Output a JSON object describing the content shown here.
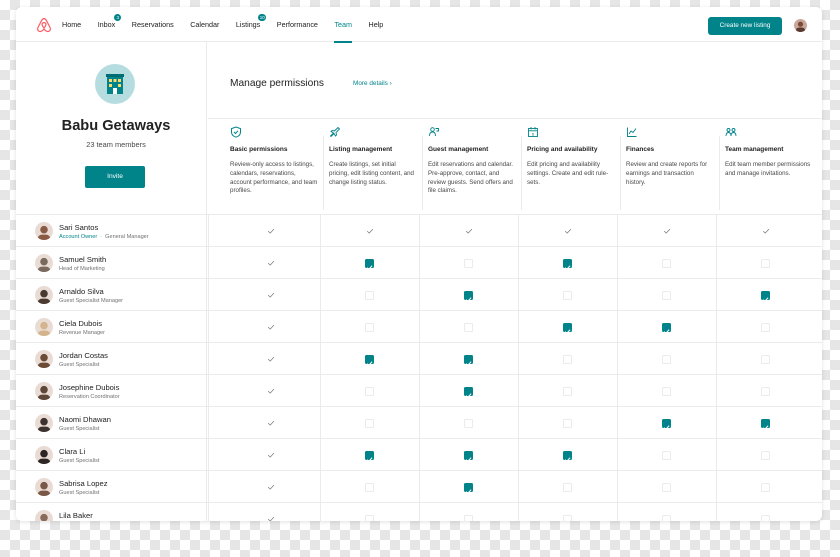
{
  "nav": {
    "items": [
      {
        "label": "Home",
        "badge": null,
        "active": false
      },
      {
        "label": "Inbox",
        "badge": "3",
        "active": false
      },
      {
        "label": "Reservations",
        "badge": null,
        "active": false
      },
      {
        "label": "Calendar",
        "badge": null,
        "active": false
      },
      {
        "label": "Listings",
        "badge": "10",
        "active": false
      },
      {
        "label": "Performance",
        "badge": null,
        "active": false
      },
      {
        "label": "Team",
        "badge": null,
        "active": true
      },
      {
        "label": "Help",
        "badge": null,
        "active": false
      }
    ],
    "create_button": "Create new listing"
  },
  "team": {
    "name": "Babu Getaways",
    "member_count": "23 team members",
    "invite_label": "Invite"
  },
  "permissions": {
    "title": "Manage permissions",
    "more_details": "More details",
    "columns": [
      {
        "name": "Basic permissions",
        "icon": "shield-icon",
        "description": "Review-only access to listings, calendars, reservations, account performance, and team profiles."
      },
      {
        "name": "Listing management",
        "icon": "pin-icon",
        "description": "Create listings, set initial pricing, edit listing content, and change listing status."
      },
      {
        "name": "Guest management",
        "icon": "guests-icon",
        "description": "Edit reservations and calendar. Pre-approve, contact, and review guests. Send offers and file claims."
      },
      {
        "name": "Pricing and availability",
        "icon": "calendar-icon",
        "description": "Edit pricing and availability settings. Create and edit rule-sets."
      },
      {
        "name": "Finances",
        "icon": "chart-icon",
        "description": "Review and create reports for earnings and transaction history."
      },
      {
        "name": "Team management",
        "icon": "team-icon",
        "description": "Edit team member permissions and manage invitations."
      }
    ]
  },
  "members": [
    {
      "name": "Sari Santos",
      "owner_label": "Account Owner",
      "role": "General Manager",
      "perms": [
        true,
        true,
        true,
        true,
        true,
        true
      ],
      "locked": true,
      "avatar": "#8a5a44"
    },
    {
      "name": "Samuel Smith",
      "owner_label": null,
      "role": "Head of Marketing",
      "perms": [
        true,
        true,
        false,
        true,
        false,
        false
      ],
      "locked": false,
      "avatar": "#7a6a5e"
    },
    {
      "name": "Arnaldo Silva",
      "owner_label": null,
      "role": "Guest Specialist Manager",
      "perms": [
        true,
        false,
        true,
        false,
        false,
        true
      ],
      "locked": false,
      "avatar": "#4a3a30"
    },
    {
      "name": "Ciela Dubois",
      "owner_label": null,
      "role": "Revenue Manager",
      "perms": [
        true,
        false,
        false,
        true,
        true,
        false
      ],
      "locked": false,
      "avatar": "#d4b48c"
    },
    {
      "name": "Jordan Costas",
      "owner_label": null,
      "role": "Guest Specialist",
      "perms": [
        true,
        true,
        true,
        false,
        false,
        false
      ],
      "locked": false,
      "avatar": "#6b4a36"
    },
    {
      "name": "Josephine Dubois",
      "owner_label": null,
      "role": "Reservation Coordinator",
      "perms": [
        true,
        false,
        true,
        false,
        false,
        false
      ],
      "locked": false,
      "avatar": "#5e4638"
    },
    {
      "name": "Naomi Dhawan",
      "owner_label": null,
      "role": "Guest Specialist",
      "perms": [
        true,
        false,
        false,
        false,
        true,
        true
      ],
      "locked": false,
      "avatar": "#3e3230"
    },
    {
      "name": "Clara Li",
      "owner_label": null,
      "role": "Guest Specialist",
      "perms": [
        true,
        true,
        true,
        true,
        false,
        false
      ],
      "locked": false,
      "avatar": "#2e2624"
    },
    {
      "name": "Sabrisa Lopez",
      "owner_label": null,
      "role": "Guest Specialist",
      "perms": [
        true,
        false,
        true,
        false,
        false,
        false
      ],
      "locked": false,
      "avatar": "#7a5848"
    },
    {
      "name": "Lila Baker",
      "owner_label": null,
      "role": "",
      "perms": [
        true,
        false,
        false,
        false,
        false,
        false
      ],
      "locked": false,
      "avatar": "#8a6a58"
    }
  ],
  "colors": {
    "accent": "#00848a",
    "logo": "#ff5a5f",
    "company_logo_bg": "#b5dde0"
  }
}
